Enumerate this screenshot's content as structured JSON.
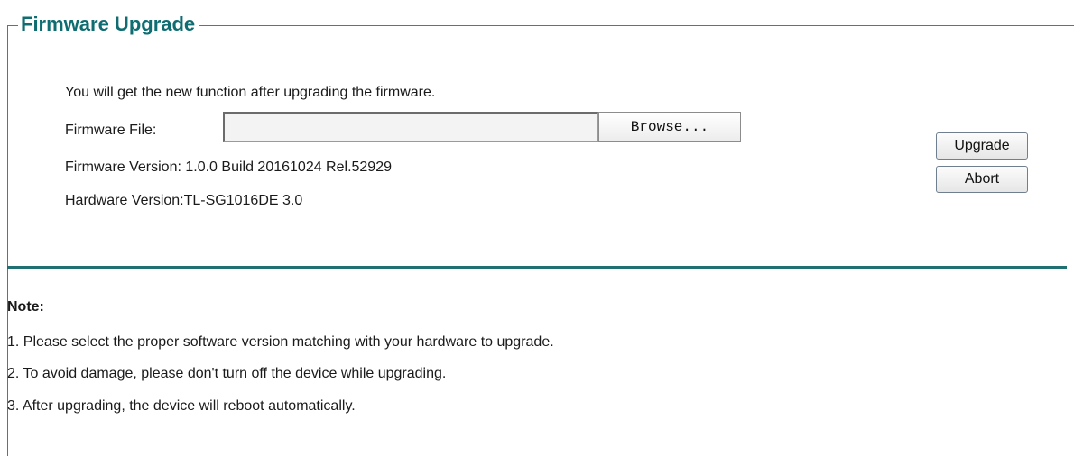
{
  "page": {
    "title": "Firmware Upgrade",
    "intro": "You will get the new function after upgrading the firmware."
  },
  "firmware_file": {
    "label": "Firmware File:",
    "value": "",
    "browse_label": "Browse..."
  },
  "versions": {
    "firmware": "Firmware Version: 1.0.0 Build 20161024 Rel.52929",
    "hardware": "Hardware Version:TL-SG1016DE 3.0"
  },
  "actions": {
    "upgrade_label": "Upgrade",
    "abort_label": "Abort"
  },
  "note": {
    "title": "Note:",
    "items": [
      "1. Please select the proper software version matching with your hardware to upgrade.",
      "2. To avoid damage, please don't turn off the device while upgrading.",
      "3. After upgrading, the device will reboot automatically."
    ]
  },
  "colors": {
    "heading": "#0f6d72",
    "divider": "#1f6f73"
  }
}
